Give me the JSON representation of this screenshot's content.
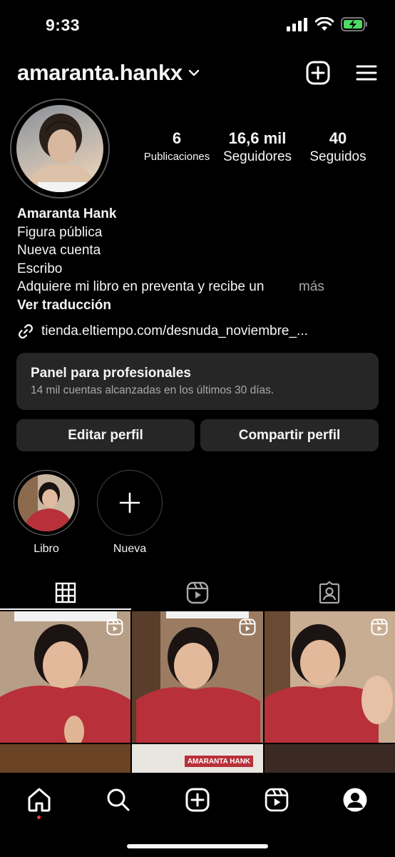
{
  "status_bar": {
    "time": "9:33",
    "battery_color": "#4cd964"
  },
  "header": {
    "username": "amaranta.hankx",
    "icons": [
      "chevron-down-icon",
      "new-post-icon",
      "menu-icon"
    ]
  },
  "stats": [
    {
      "value": "6",
      "label": "Publicaciones"
    },
    {
      "value": "16,6 mil",
      "label": "Seguidores"
    },
    {
      "value": "40",
      "label": "Seguidos"
    }
  ],
  "bio": {
    "name": "Amaranta Hank",
    "lines": [
      "Figura pública",
      "Nueva cuenta",
      "Escribo",
      "Adquiere mi libro en preventa y recibe un"
    ],
    "more": "más",
    "translate": "Ver traducción"
  },
  "link": {
    "text": "tienda.eltiempo.com/desnuda_noviembre_..."
  },
  "pro_panel": {
    "title": "Panel para profesionales",
    "subtitle": "14 mil cuentas alcanzadas en los últimos 30 días."
  },
  "actions": {
    "edit": "Editar perfil",
    "share": "Compartir perfil"
  },
  "highlights": [
    {
      "label": "Libro"
    },
    {
      "label": "Nueva"
    }
  ],
  "tabs": [
    "grid-icon",
    "reels-icon",
    "tagged-icon"
  ],
  "grid_posts": [
    {
      "type": "reel"
    },
    {
      "type": "reel"
    },
    {
      "type": "reel"
    },
    {
      "type": "post",
      "text": "AMARANTA HANK"
    }
  ],
  "colors": {
    "accent_notification": "#ff3040",
    "panel_bg": "#262626",
    "hoodie_red": "#b8303a"
  }
}
